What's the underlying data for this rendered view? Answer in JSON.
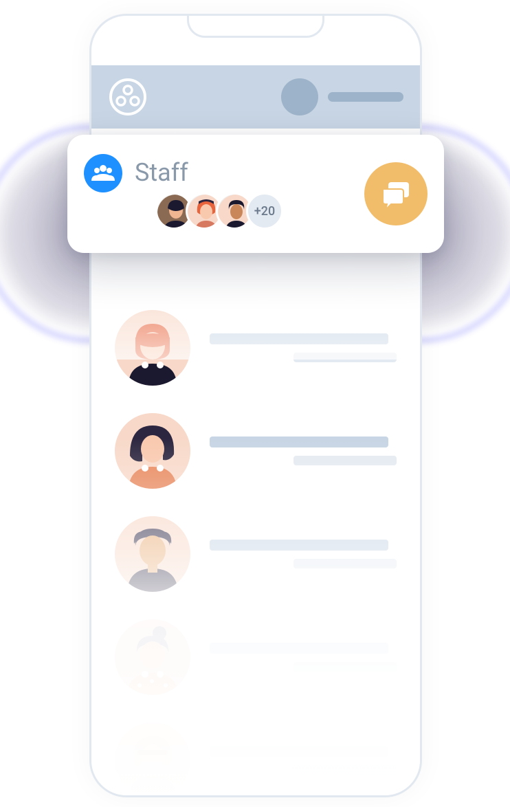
{
  "colors": {
    "header": "#c7d5e4",
    "headerDim": "#9db3c9",
    "groupIcon": "#1e90ff",
    "chatButton": "#f2bd6b",
    "titleText": "#8a99aa",
    "linePrimary": "#c7d5e4",
    "lineSecondary": "#e4eaf1",
    "avatarBg": "#f8d9c9"
  },
  "staffCard": {
    "title": "Staff",
    "overflowCount": "+20",
    "members": [
      {
        "id": "member-1"
      },
      {
        "id": "member-2"
      },
      {
        "id": "member-3"
      }
    ]
  },
  "contacts": [
    {
      "id": "contact-1"
    },
    {
      "id": "contact-2"
    },
    {
      "id": "contact-3"
    },
    {
      "id": "contact-4"
    },
    {
      "id": "contact-5"
    }
  ]
}
